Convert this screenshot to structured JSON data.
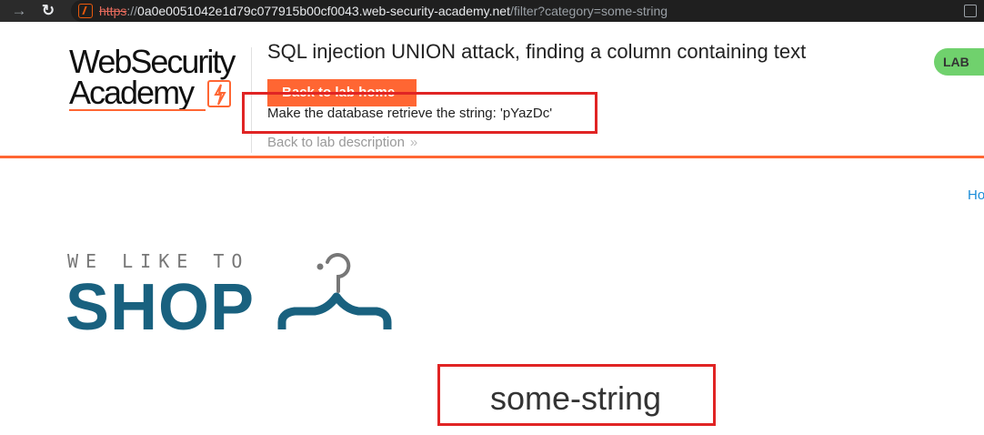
{
  "browser": {
    "back_icon": "back-arrow-icon",
    "reload_icon": "reload-icon",
    "url": {
      "scheme": "https",
      "sep": "://",
      "host": "0a0e0051042e1d79c077915b00cf0043.web-security-academy.net",
      "path": "/filter?category=some-string"
    }
  },
  "header": {
    "logo_line1": "WebSecurity",
    "logo_line2": "Academy",
    "title": "SQL injection UNION attack, finding a column containing text",
    "back_button": "Back to lab home",
    "objective": "Make the database retrieve the string: 'pYazDc'",
    "back_description": "Back to lab description",
    "badge": "LAB",
    "accent_color": "#ff6633",
    "badge_color": "#70d16d"
  },
  "page": {
    "nav_link": "Ho",
    "shop_tagline": "WE LIKE TO",
    "shop_word": "SHOP",
    "search_term": "some-string",
    "brand_color": "#19617f"
  },
  "annotations": {
    "highlight_color": "#e02424"
  }
}
